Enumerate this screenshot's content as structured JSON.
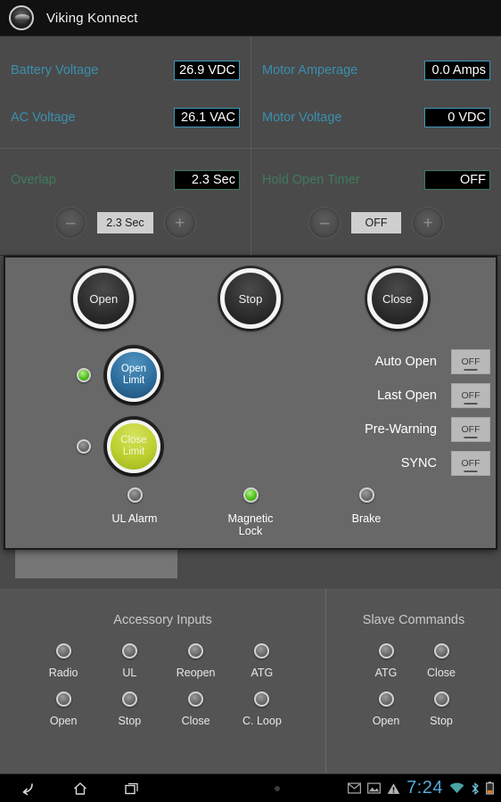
{
  "titlebar": {
    "app_title": "Viking Konnect",
    "logo_icon": "viking-logo-icon"
  },
  "metrics": {
    "left": [
      {
        "label": "Battery Voltage",
        "value": "26.9 VDC"
      },
      {
        "label": "AC Voltage",
        "value": "26.1 VAC"
      }
    ],
    "right": [
      {
        "label": "Motor Amperage",
        "value": "0.0 Amps"
      },
      {
        "label": "Motor Voltage",
        "value": "0 VDC"
      }
    ],
    "label_color": "#3a8fae",
    "box_border_color": "#3f97b8"
  },
  "timers": {
    "left": {
      "label": "Overlap",
      "value": "2.3 Sec",
      "stepper_value": "2.3 Sec",
      "minus_label": "–",
      "plus_label": "+"
    },
    "right": {
      "label": "Hold Open Timer",
      "value": "OFF",
      "stepper_value": "OFF",
      "minus_label": "–",
      "plus_label": "+"
    },
    "label_color": "#3e7c5c",
    "box_border_color": "#3e7c5c"
  },
  "modal": {
    "commands": [
      {
        "label": "Open"
      },
      {
        "label": "Stop"
      },
      {
        "label": "Close"
      }
    ],
    "limits": [
      {
        "label_line1": "Open",
        "label_line2": "Limit",
        "color": "blue",
        "led_state": "on"
      },
      {
        "label_line1": "Close",
        "label_line2": "Limit",
        "color": "green",
        "led_state": "off"
      }
    ],
    "toggles": [
      {
        "label": "Auto Open",
        "value": "OFF"
      },
      {
        "label": "Last Open",
        "value": "OFF"
      },
      {
        "label": "Pre-Warning",
        "value": "OFF"
      },
      {
        "label": "SYNC",
        "value": "OFF"
      }
    ],
    "status_leds": [
      {
        "label": "UL Alarm",
        "state": "off"
      },
      {
        "label": "Magnetic Lock",
        "state": "on"
      },
      {
        "label": "Brake",
        "state": "off"
      }
    ]
  },
  "bottom": {
    "accessory": {
      "title": "Accessory Inputs",
      "items": [
        {
          "label": "Radio",
          "state": "off"
        },
        {
          "label": "UL",
          "state": "off"
        },
        {
          "label": "Reopen",
          "state": "off"
        },
        {
          "label": "ATG",
          "state": "off"
        },
        {
          "label": "Open",
          "state": "off"
        },
        {
          "label": "Stop",
          "state": "off"
        },
        {
          "label": "Close",
          "state": "off"
        },
        {
          "label": "C. Loop",
          "state": "off"
        }
      ]
    },
    "slave": {
      "title": "Slave Commands",
      "items": [
        {
          "label": "ATG",
          "state": "off"
        },
        {
          "label": "Close",
          "state": "off"
        },
        {
          "label": "Open",
          "state": "off"
        },
        {
          "label": "Stop",
          "state": "off"
        }
      ]
    }
  },
  "systembar": {
    "nav": [
      {
        "icon": "back-icon"
      },
      {
        "icon": "home-icon"
      },
      {
        "icon": "recents-icon"
      }
    ],
    "status_icons": [
      {
        "icon": "gmail-icon"
      },
      {
        "icon": "screenshot-icon"
      },
      {
        "icon": "warning-icon"
      }
    ],
    "clock": "7:24",
    "right_icons": [
      {
        "icon": "wifi-icon"
      },
      {
        "icon": "bluetooth-icon"
      },
      {
        "icon": "battery-icon"
      }
    ],
    "clock_color": "#53a8d8"
  }
}
